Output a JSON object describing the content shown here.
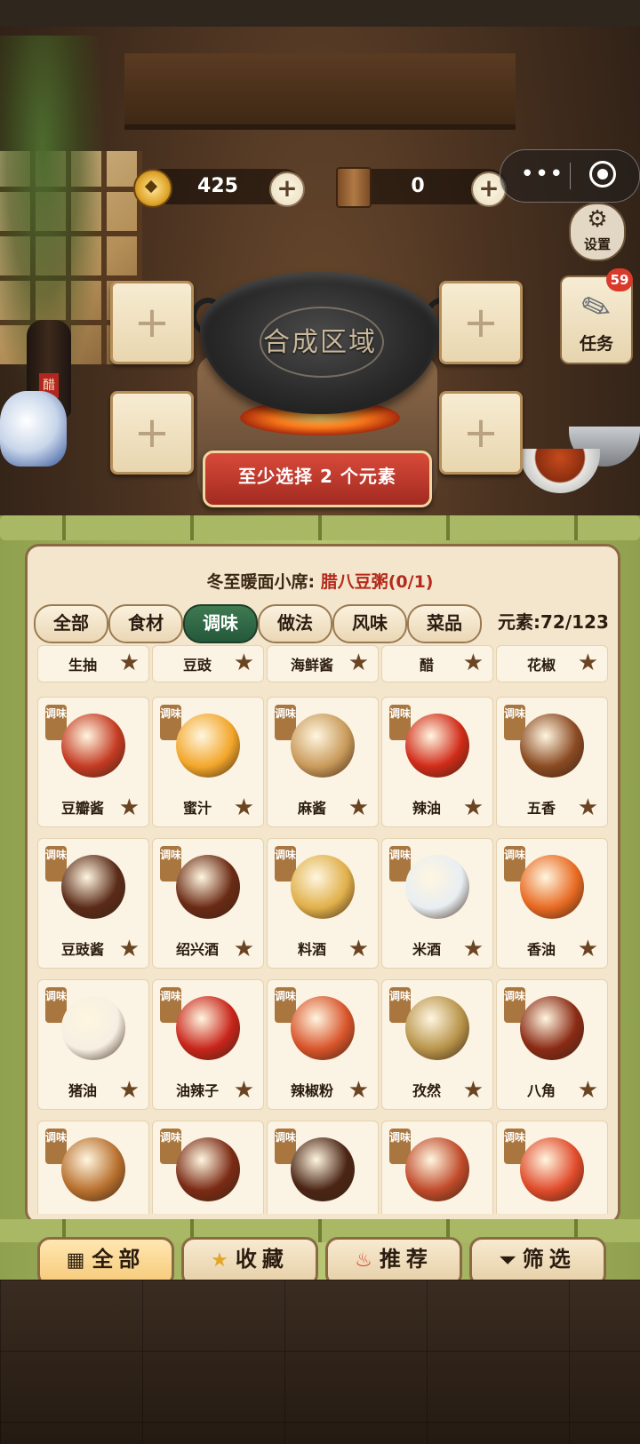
{
  "hud": {
    "coins": "425",
    "books": "0",
    "settings_label": "设置",
    "task_label": "任务",
    "task_badge": "59"
  },
  "wok": {
    "label": "合成区域"
  },
  "hint_button": "至少选择 2 个元素",
  "panel": {
    "title_prefix": "冬至暖面小席: ",
    "title_recipe": "腊八豆粥(0/1)",
    "tabs": [
      "全部",
      "食材",
      "调味",
      "做法",
      "风味",
      "菜品"
    ],
    "active_tab": "调味",
    "element_count": "元素:72/123"
  },
  "items_row0": [
    "生抽",
    "豆豉",
    "海鲜酱",
    "醋",
    "花椒"
  ],
  "items": [
    {
      "tag": "调味",
      "name": "豆瓣酱",
      "color": "#c43a22"
    },
    {
      "tag": "调味",
      "name": "蜜汁",
      "color": "#f2a62a"
    },
    {
      "tag": "调味",
      "name": "麻酱",
      "color": "#c99a5a"
    },
    {
      "tag": "调味",
      "name": "辣油",
      "color": "#d02a18"
    },
    {
      "tag": "调味",
      "name": "五香",
      "color": "#8a4a22"
    },
    {
      "tag": "调味",
      "name": "豆豉酱",
      "color": "#5a2a18"
    },
    {
      "tag": "调味",
      "name": "绍兴酒",
      "color": "#6a2a14"
    },
    {
      "tag": "调味",
      "name": "料酒",
      "color": "#e0b04a"
    },
    {
      "tag": "调味",
      "name": "米酒",
      "color": "#e8eef2"
    },
    {
      "tag": "调味",
      "name": "香油",
      "color": "#e86a22"
    },
    {
      "tag": "调味",
      "name": "猪油",
      "color": "#f6efe2"
    },
    {
      "tag": "调味",
      "name": "油辣子",
      "color": "#c8241a"
    },
    {
      "tag": "调味",
      "name": "辣椒粉",
      "color": "#d8542a"
    },
    {
      "tag": "调味",
      "name": "孜然",
      "color": "#b8944a"
    },
    {
      "tag": "调味",
      "name": "八角",
      "color": "#8a2a14"
    },
    {
      "tag": "调味",
      "name": "",
      "color": "#b8702e"
    },
    {
      "tag": "调味",
      "name": "",
      "color": "#7a2a14"
    },
    {
      "tag": "调味",
      "name": "",
      "color": "#4a2414"
    },
    {
      "tag": "调味",
      "name": "",
      "color": "#c04a2a"
    },
    {
      "tag": "调味",
      "name": "",
      "color": "#e04a2a"
    }
  ],
  "bottom_bar": [
    {
      "icon": "grid-icon",
      "label": "全部"
    },
    {
      "icon": "star-icon",
      "label": "收藏"
    },
    {
      "icon": "fire-icon",
      "label": "推荐"
    },
    {
      "icon": "filter-icon",
      "label": "筛选"
    }
  ]
}
